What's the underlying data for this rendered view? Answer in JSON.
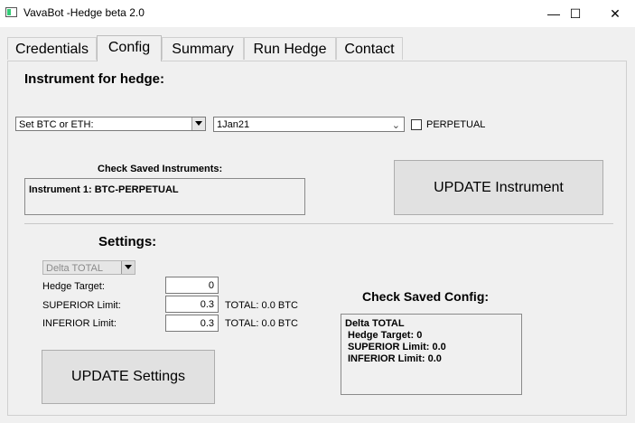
{
  "window": {
    "title": "VavaBot -Hedge beta 2.0",
    "minimize": "—",
    "maximize": "☐",
    "close": "✕"
  },
  "tabs": [
    "Credentials",
    "Config",
    "Summary",
    "Run Hedge",
    "Contact"
  ],
  "instrument": {
    "heading": "Instrument for hedge:",
    "coin_select": "Set BTC or ETH:",
    "expiry_select": "1Jan21",
    "perpetual_label": "PERPETUAL",
    "saved_heading": "Check Saved Instruments:",
    "saved_value": "Instrument 1: BTC-PERPETUAL",
    "update_button": "UPDATE Instrument"
  },
  "settings": {
    "heading": "Settings:",
    "mode_select": "Delta TOTAL",
    "hedge_target_label": "Hedge Target:",
    "hedge_target_value": "0",
    "superior_label": "SUPERIOR Limit:",
    "superior_value": "0.3",
    "superior_total": "TOTAL: 0.0 BTC",
    "inferior_label": "INFERIOR Limit:",
    "inferior_value": "0.3",
    "inferior_total": "TOTAL: 0.0 BTC",
    "update_button": "UPDATE Settings"
  },
  "saved_config": {
    "heading": "Check Saved Config:",
    "line1": "Delta TOTAL",
    "line2": "Hedge Target: 0",
    "line3": "SUPERIOR Limit: 0.0",
    "line4": "INFERIOR Limit: 0.0"
  }
}
